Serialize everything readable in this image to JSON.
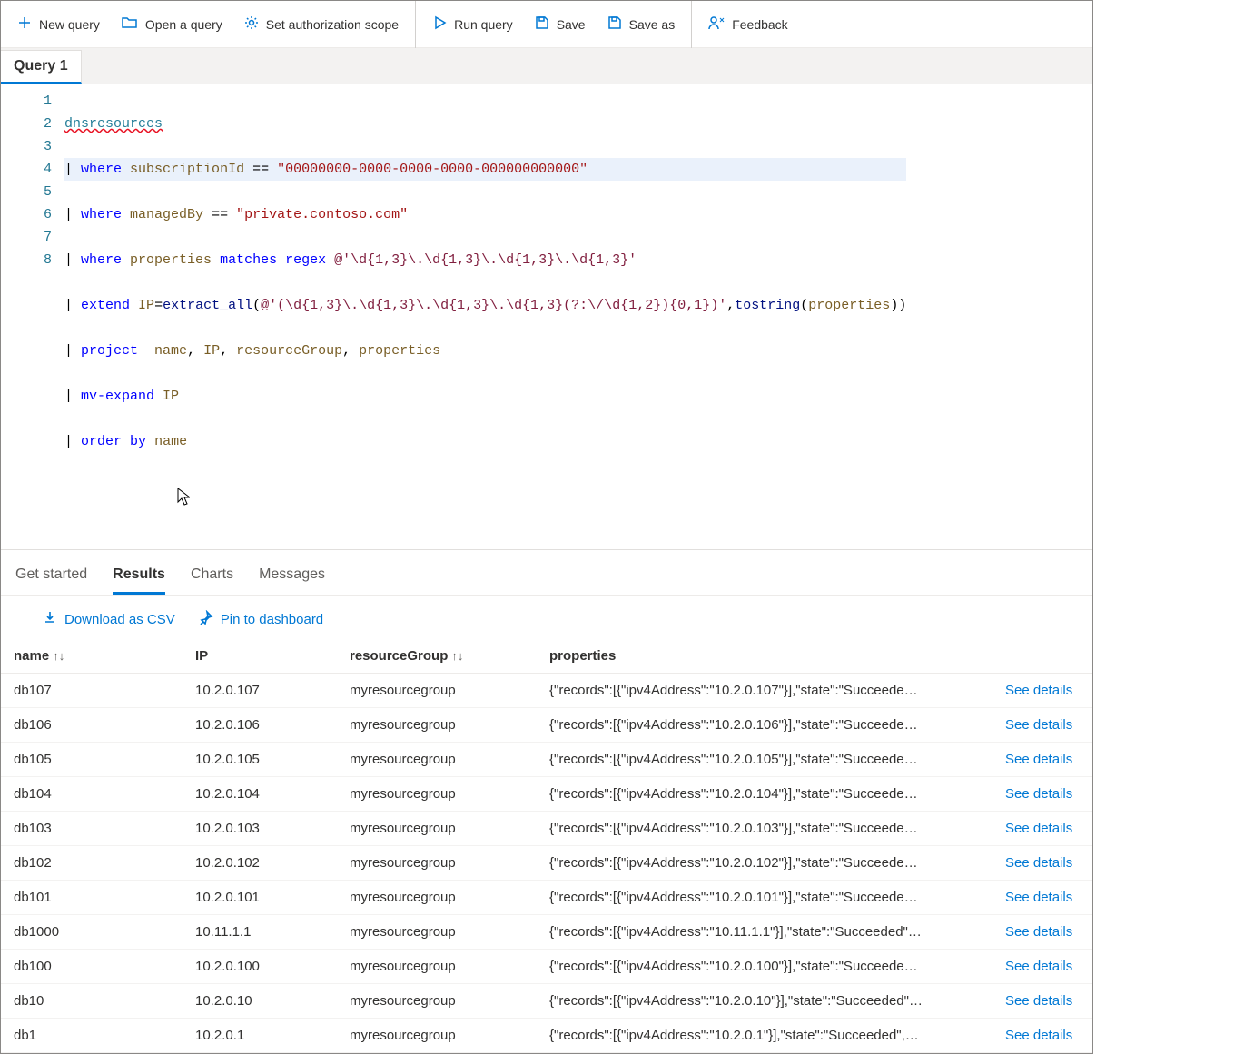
{
  "toolbar": {
    "new_query": "New query",
    "open_query": "Open a query",
    "auth_scope": "Set authorization scope",
    "run_query": "Run query",
    "save": "Save",
    "save_as": "Save as",
    "feedback": "Feedback"
  },
  "query_tabs": {
    "active": "Query 1"
  },
  "code_tokens": {
    "dnsresources": "dnsresources",
    "where": "where",
    "subscriptionId": "subscriptionId",
    "eq": "==",
    "sub_guid": "\"00000000-0000-0000-0000-000000000000\"",
    "managedBy": "managedBy",
    "mb_val": "\"private.contoso.com\"",
    "properties": "properties",
    "matches_regex": "matches regex",
    "regex1": "@'\\d{1,3}\\.\\d{1,3}\\.\\d{1,3}\\.\\d{1,3}'",
    "extend": "extend",
    "IP": "IP",
    "extract_all": "extract_all",
    "regex2": "@'(\\d{1,3}\\.\\d{1,3}\\.\\d{1,3}\\.\\d{1,3}(?:\\/\\d{1,2}){0,1})'",
    "tostring": "tostring",
    "project": "project",
    "name": "name",
    "resourceGroup": "resourceGroup",
    "mv_expand": "mv-expand",
    "order": "order",
    "by": "by"
  },
  "line_numbers": [
    "1",
    "2",
    "3",
    "4",
    "5",
    "6",
    "7",
    "8"
  ],
  "panel_tabs": {
    "get_started": "Get started",
    "results": "Results",
    "charts": "Charts",
    "messages": "Messages"
  },
  "actions": {
    "download_csv": "Download as CSV",
    "pin_dashboard": "Pin to dashboard"
  },
  "columns": {
    "name": "name",
    "ip": "IP",
    "rg": "resourceGroup",
    "props": "properties"
  },
  "see_details": "See details",
  "rows": [
    {
      "name": "db107",
      "ip": "10.2.0.107",
      "rg": "myresourcegroup",
      "props": "{\"records\":[{\"ipv4Address\":\"10.2.0.107\"}],\"state\":\"Succeede…"
    },
    {
      "name": "db106",
      "ip": "10.2.0.106",
      "rg": "myresourcegroup",
      "props": "{\"records\":[{\"ipv4Address\":\"10.2.0.106\"}],\"state\":\"Succeede…"
    },
    {
      "name": "db105",
      "ip": "10.2.0.105",
      "rg": "myresourcegroup",
      "props": "{\"records\":[{\"ipv4Address\":\"10.2.0.105\"}],\"state\":\"Succeede…"
    },
    {
      "name": "db104",
      "ip": "10.2.0.104",
      "rg": "myresourcegroup",
      "props": "{\"records\":[{\"ipv4Address\":\"10.2.0.104\"}],\"state\":\"Succeede…"
    },
    {
      "name": "db103",
      "ip": "10.2.0.103",
      "rg": "myresourcegroup",
      "props": "{\"records\":[{\"ipv4Address\":\"10.2.0.103\"}],\"state\":\"Succeede…"
    },
    {
      "name": "db102",
      "ip": "10.2.0.102",
      "rg": "myresourcegroup",
      "props": "{\"records\":[{\"ipv4Address\":\"10.2.0.102\"}],\"state\":\"Succeede…"
    },
    {
      "name": "db101",
      "ip": "10.2.0.101",
      "rg": "myresourcegroup",
      "props": "{\"records\":[{\"ipv4Address\":\"10.2.0.101\"}],\"state\":\"Succeede…"
    },
    {
      "name": "db1000",
      "ip": "10.11.1.1",
      "rg": "myresourcegroup",
      "props": "{\"records\":[{\"ipv4Address\":\"10.11.1.1\"}],\"state\":\"Succeeded\"…"
    },
    {
      "name": "db100",
      "ip": "10.2.0.100",
      "rg": "myresourcegroup",
      "props": "{\"records\":[{\"ipv4Address\":\"10.2.0.100\"}],\"state\":\"Succeede…"
    },
    {
      "name": "db10",
      "ip": "10.2.0.10",
      "rg": "myresourcegroup",
      "props": "{\"records\":[{\"ipv4Address\":\"10.2.0.10\"}],\"state\":\"Succeeded\"…"
    },
    {
      "name": "db1",
      "ip": "10.2.0.1",
      "rg": "myresourcegroup",
      "props": "{\"records\":[{\"ipv4Address\":\"10.2.0.1\"}],\"state\":\"Succeeded\",…"
    }
  ]
}
